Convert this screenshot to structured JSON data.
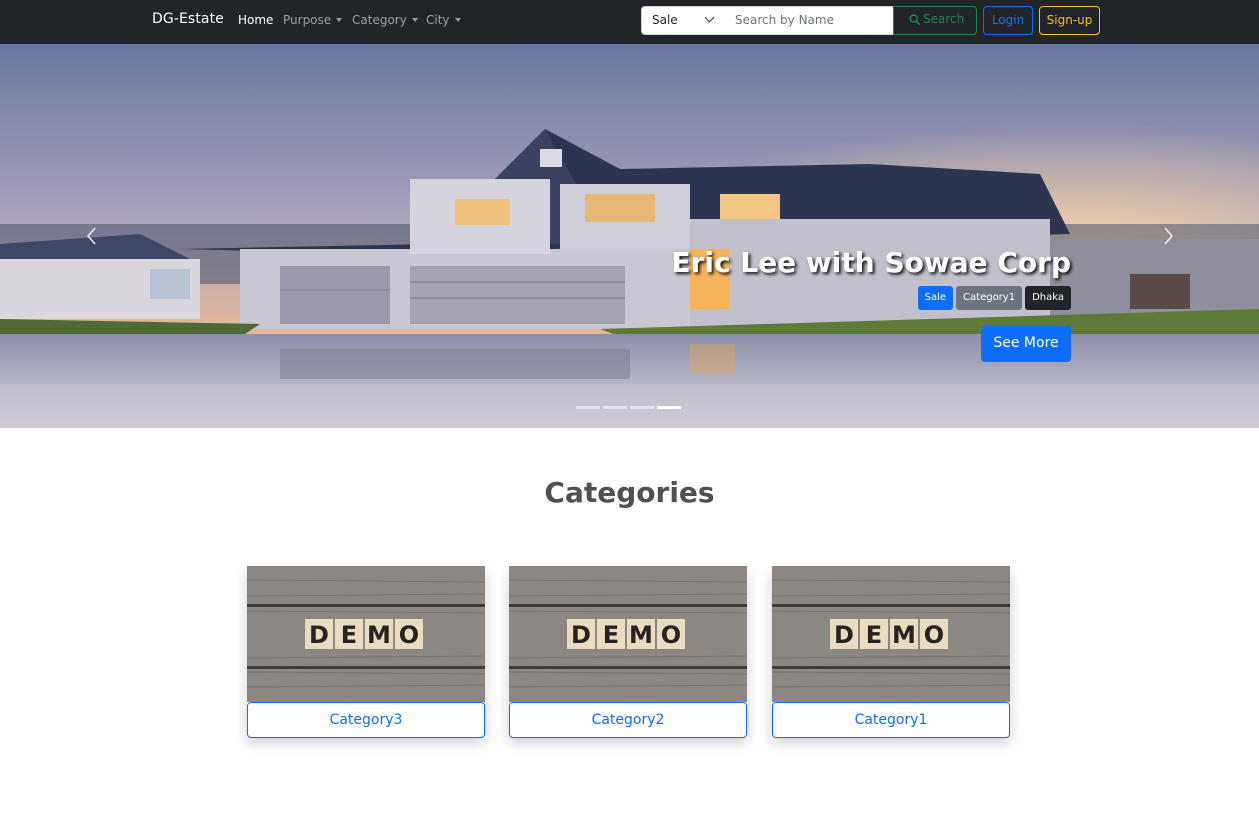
{
  "navbar": {
    "brand": "DG-Estate",
    "links": [
      {
        "label": "Home",
        "active": true,
        "dropdown": false
      },
      {
        "label": "Purpose",
        "active": false,
        "dropdown": true
      },
      {
        "label": "Category",
        "active": false,
        "dropdown": true
      },
      {
        "label": "City",
        "active": false,
        "dropdown": true
      }
    ],
    "purpose_select": {
      "value": "Sale"
    },
    "search": {
      "placeholder": "Search by Name",
      "button_label": "Search"
    },
    "login_label": "Login",
    "signup_label": "Sign-up"
  },
  "hero": {
    "title": "Eric Lee with Sowae Corp",
    "badges": [
      {
        "label": "Sale",
        "color": "#0d6efd"
      },
      {
        "label": "Category1",
        "color": "#6c757d"
      },
      {
        "label": "Dhaka",
        "color": "#212529"
      }
    ],
    "cta_label": "See More",
    "slide_count": 4,
    "active_slide": 4
  },
  "categories": {
    "title": "Categories",
    "image_text": "DEMO",
    "items": [
      {
        "label": "Category3"
      },
      {
        "label": "Category2"
      },
      {
        "label": "Category1"
      }
    ]
  },
  "colors": {
    "navbar_bg": "#212529",
    "primary": "#0d6efd",
    "success": "#198754",
    "warning": "#ffc107"
  }
}
